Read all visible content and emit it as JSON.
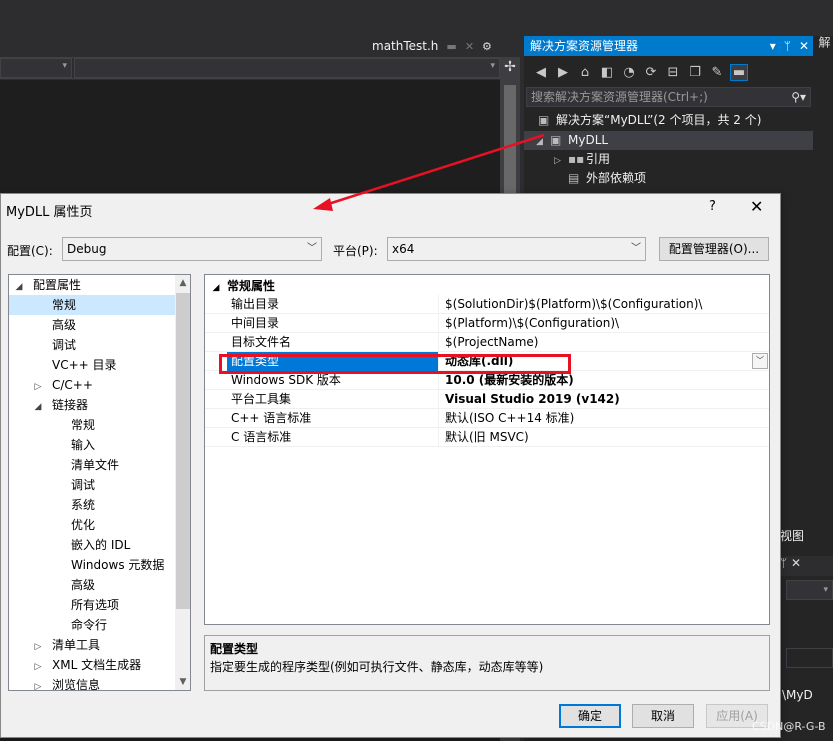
{
  "vs": {
    "doc_tab": "mathTest.h",
    "solution_explorer": {
      "title": "解决方案资源管理器",
      "search_placeholder": "搜索解决方案资源管理器(Ctrl+;)",
      "tree": [
        {
          "label": "解决方案“MyDLL”(2 个项目，共 2 个)"
        },
        {
          "label": "MyDLL"
        },
        {
          "label": "引用"
        },
        {
          "label": "外部依赖项"
        }
      ]
    },
    "bottom_pane_fragment": "视图",
    "bottom_pane_text": "\\MyD",
    "watermark": "CSDN@R-G-B"
  },
  "dialog": {
    "title": "MyDLL 属性页",
    "help": "?",
    "close": "✕",
    "config_label": "配置(C):",
    "config_value": "Debug",
    "platform_label": "平台(P):",
    "platform_value": "x64",
    "config_manager_button": "配置管理器(O)...",
    "tree": [
      {
        "label": "配置属性",
        "indent": 0,
        "expander": "◢",
        "selected": false
      },
      {
        "label": "常规",
        "indent": 1,
        "expander": "",
        "selected": true
      },
      {
        "label": "高级",
        "indent": 1,
        "expander": "",
        "selected": false
      },
      {
        "label": "调试",
        "indent": 1,
        "expander": "",
        "selected": false
      },
      {
        "label": "VC++ 目录",
        "indent": 1,
        "expander": "",
        "selected": false
      },
      {
        "label": "C/C++",
        "indent": 1,
        "expander": "▷",
        "selected": false
      },
      {
        "label": "链接器",
        "indent": 1,
        "expander": "◢",
        "selected": false
      },
      {
        "label": "常规",
        "indent": 2,
        "expander": "",
        "selected": false
      },
      {
        "label": "输入",
        "indent": 2,
        "expander": "",
        "selected": false
      },
      {
        "label": "清单文件",
        "indent": 2,
        "expander": "",
        "selected": false
      },
      {
        "label": "调试",
        "indent": 2,
        "expander": "",
        "selected": false
      },
      {
        "label": "系统",
        "indent": 2,
        "expander": "",
        "selected": false
      },
      {
        "label": "优化",
        "indent": 2,
        "expander": "",
        "selected": false
      },
      {
        "label": "嵌入的 IDL",
        "indent": 2,
        "expander": "",
        "selected": false
      },
      {
        "label": "Windows 元数据",
        "indent": 2,
        "expander": "",
        "selected": false
      },
      {
        "label": "高级",
        "indent": 2,
        "expander": "",
        "selected": false
      },
      {
        "label": "所有选项",
        "indent": 2,
        "expander": "",
        "selected": false
      },
      {
        "label": "命令行",
        "indent": 2,
        "expander": "",
        "selected": false
      },
      {
        "label": "清单工具",
        "indent": 1,
        "expander": "▷",
        "selected": false
      },
      {
        "label": "XML 文档生成器",
        "indent": 1,
        "expander": "▷",
        "selected": false
      },
      {
        "label": "浏览信息",
        "indent": 1,
        "expander": "▷",
        "selected": false
      }
    ],
    "grid": {
      "category": "常规属性",
      "rows": [
        {
          "name": "输出目录",
          "value": "$(SolutionDir)$(Platform)\\$(Configuration)\\",
          "bold": false,
          "selected": false
        },
        {
          "name": "中间目录",
          "value": "$(Platform)\\$(Configuration)\\",
          "bold": false,
          "selected": false
        },
        {
          "name": "目标文件名",
          "value": "$(ProjectName)",
          "bold": false,
          "selected": false
        },
        {
          "name": "配置类型",
          "value": "动态库(.dll)",
          "bold": true,
          "selected": true
        },
        {
          "name": "Windows SDK 版本",
          "value": "10.0 (最新安装的版本)",
          "bold": true,
          "selected": false
        },
        {
          "name": "平台工具集",
          "value": "Visual Studio 2019 (v142)",
          "bold": true,
          "selected": false
        },
        {
          "name": "C++ 语言标准",
          "value": "默认(ISO C++14 标准)",
          "bold": false,
          "selected": false
        },
        {
          "name": "C 语言标准",
          "value": "默认(旧 MSVC)",
          "bold": false,
          "selected": false
        }
      ]
    },
    "description": {
      "title": "配置类型",
      "text": "指定要生成的程序类型(例如可执行文件、静态库，动态库等等)"
    },
    "buttons": {
      "ok": "确定",
      "cancel": "取消",
      "apply": "应用(A)"
    }
  },
  "colors": {
    "accent": "#007acc",
    "selection": "#0078d7",
    "highlight_box": "#e81123",
    "arrow": "#e81123"
  }
}
